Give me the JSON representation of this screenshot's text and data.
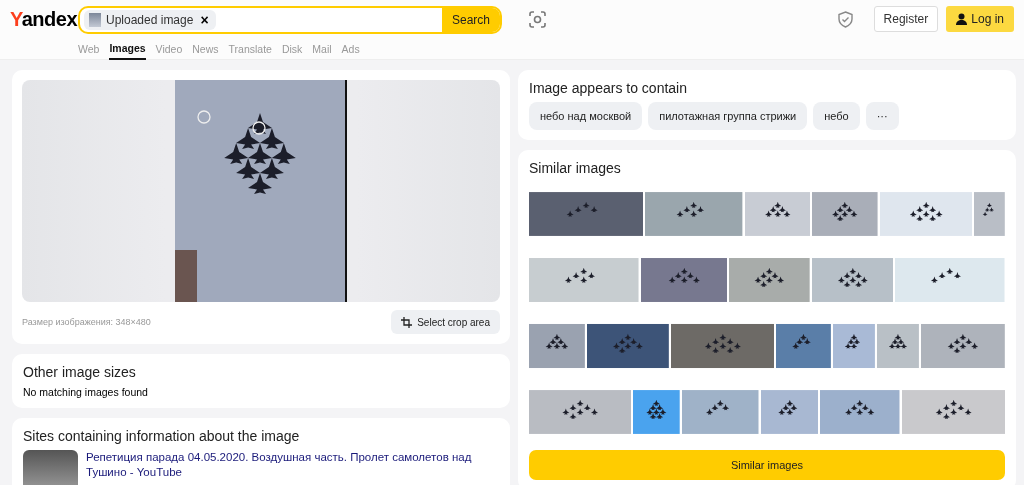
{
  "header": {
    "logo": "Yandex",
    "search": {
      "chip_label": "Uploaded image",
      "chip_remove": "×",
      "button": "Search"
    },
    "register": "Register",
    "login": "Log in"
  },
  "nav_tabs": [
    {
      "label": "Web",
      "selected": false
    },
    {
      "label": "Images",
      "selected": true
    },
    {
      "label": "Video",
      "selected": false
    },
    {
      "label": "News",
      "selected": false
    },
    {
      "label": "Translate",
      "selected": false
    },
    {
      "label": "Disk",
      "selected": false
    },
    {
      "label": "Mail",
      "selected": false
    },
    {
      "label": "Ads",
      "selected": false
    }
  ],
  "preview": {
    "size_text": "Размер изображения: 348×480",
    "crop_button": "Select crop area"
  },
  "other_sizes": {
    "title": "Other image sizes",
    "message": "No matching images found"
  },
  "sites": {
    "title": "Sites containing information about the image",
    "results": [
      {
        "link": "Репетиция парада 04.05.2020. Воздушная часть. Пролет самолетов над Тушино - YouTube"
      }
    ]
  },
  "contains": {
    "title": "Image appears to contain",
    "tags": [
      "небо над москвой",
      "пилотажная группа стрижи",
      "небо"
    ],
    "more": "···"
  },
  "similar": {
    "title": "Similar images",
    "button": "Similar images"
  }
}
